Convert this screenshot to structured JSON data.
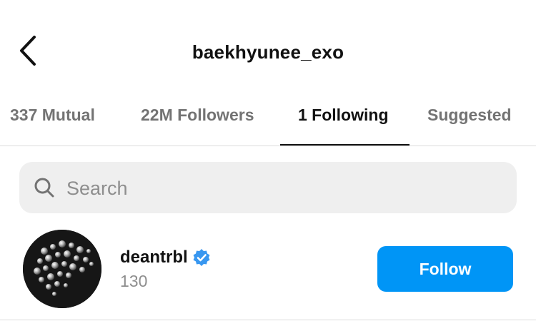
{
  "header": {
    "title": "baekhyunee_exo",
    "back_icon": "chevron-left-icon"
  },
  "tabs": [
    {
      "label": "337 Mutual",
      "active": false
    },
    {
      "label": "22M Followers",
      "active": false
    },
    {
      "label": "1 Following",
      "active": true
    },
    {
      "label": "Suggested",
      "active": false
    }
  ],
  "search": {
    "placeholder": "Search",
    "value": "",
    "icon": "search-icon"
  },
  "following_list": [
    {
      "username": "deantrbl",
      "verified": true,
      "subtext": "130",
      "action_label": "Follow"
    }
  ],
  "colors": {
    "accent": "#0095f6",
    "verified": "#3897f0",
    "muted_text": "#737373",
    "search_bg": "#efefef"
  }
}
